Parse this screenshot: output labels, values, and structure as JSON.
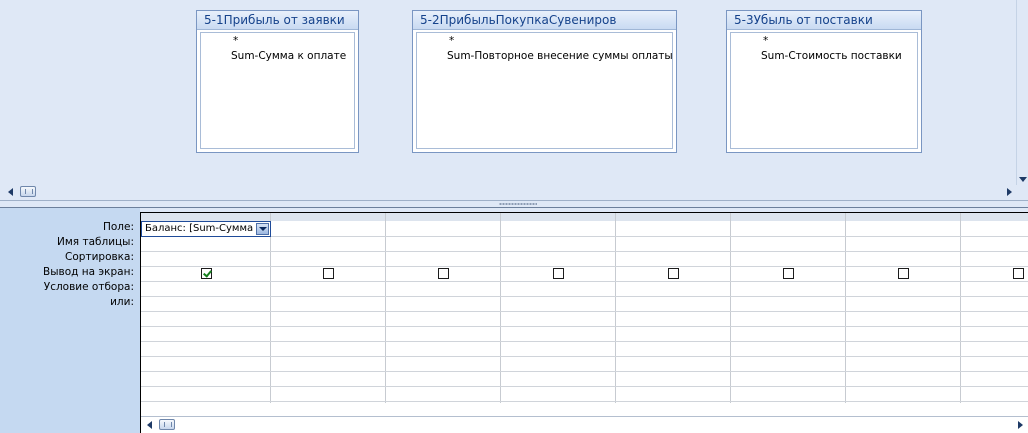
{
  "tables": [
    {
      "title": "5-1Прибыль от заявки",
      "fields": [
        "*",
        "Sum-Сумма к оплате"
      ]
    },
    {
      "title": "5-2ПрибыльПокупкаСувениров",
      "fields": [
        "*",
        "Sum-Повторное внесение суммы оплаты"
      ]
    },
    {
      "title": "5-3Убыль от поставки",
      "fields": [
        "*",
        "Sum-Стоимость поставки"
      ]
    }
  ],
  "grid": {
    "row_labels": [
      "Поле:",
      "Имя таблицы:",
      "Сортировка:",
      "Вывод на экран:",
      "Условие отбора:",
      "или:"
    ],
    "column1_field": "Баланс: [Sum-Сумма",
    "show_checked": [
      true,
      false,
      false,
      false,
      false,
      false,
      false,
      false
    ]
  },
  "icons": {
    "dropdown": "chevron-down-icon",
    "scroll_left": "arrow-left-icon",
    "scroll_right": "arrow-right-icon",
    "scroll_down": "arrow-down-icon"
  },
  "colors": {
    "pane_background": "#dfe8f6",
    "table_title_text": "#15428b",
    "row_label_background": "#c5d9f1",
    "checkbox_check": "#157f1d"
  }
}
